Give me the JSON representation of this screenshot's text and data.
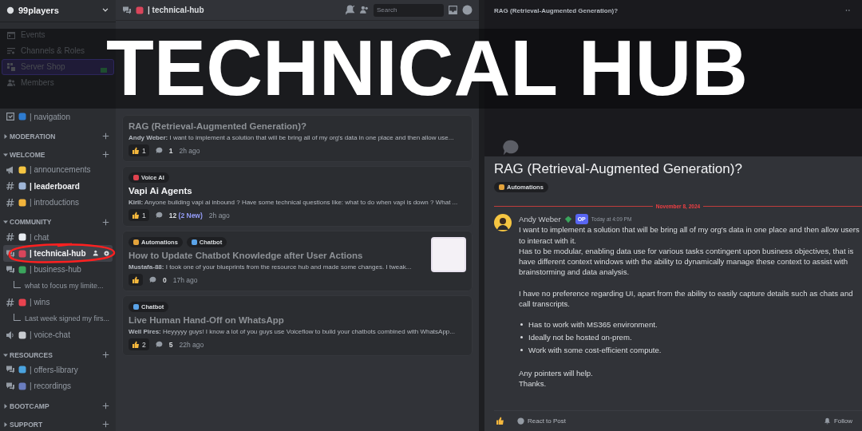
{
  "overlay_title": "TECHNICAL HUB",
  "sidebar": {
    "server_name": "99players",
    "menu": [
      {
        "kind": "events",
        "label": "Events",
        "selected": false
      },
      {
        "kind": "roles",
        "label": "Channels & Roles",
        "selected": false
      },
      {
        "kind": "shop",
        "label": "Server Shop",
        "selected": true
      },
      {
        "kind": "members",
        "label": "Members",
        "selected": false
      }
    ],
    "pinned": [
      {
        "kind": "rules",
        "label": "| navigation",
        "color": "#2e7bcf",
        "unread": false,
        "selected": false
      }
    ],
    "categories": [
      {
        "name": "MODERATION",
        "expanded": false
      },
      {
        "name": "WELCOME",
        "expanded": true,
        "channels": [
          {
            "kind": "announce",
            "label": "| announcements",
            "color": "#f5c542",
            "unread": false,
            "selected": false
          },
          {
            "kind": "text",
            "label": "| leaderboard",
            "color": "#9fb6d8",
            "unread": true,
            "selected": false
          },
          {
            "kind": "text",
            "label": "| introductions",
            "color": "#f2b43c",
            "unread": false,
            "selected": false
          }
        ]
      },
      {
        "name": "COMMUNITY",
        "expanded": true,
        "channels": [
          {
            "kind": "text",
            "label": "| chat",
            "color": "#e9edf2",
            "unread": false,
            "selected": false
          },
          {
            "kind": "forum",
            "label": "| technical-hub",
            "color": "#d9455b",
            "unread": true,
            "selected": true
          },
          {
            "kind": "forum",
            "label": "| business-hub",
            "color": "#3ba55d",
            "unread": false,
            "selected": false
          },
          {
            "kind": "thread",
            "label": "what to focus my limite...",
            "unread": false,
            "selected": false
          },
          {
            "kind": "text",
            "label": "| wins",
            "color": "#e8434f",
            "unread": false,
            "selected": false
          },
          {
            "kind": "thread",
            "label": "Last week signed my firs...",
            "unread": false,
            "selected": false
          },
          {
            "kind": "voice",
            "label": "| voice-chat",
            "color": "#c9ccd1",
            "unread": false,
            "selected": false
          }
        ]
      },
      {
        "name": "RESOURCES",
        "expanded": true,
        "channels": [
          {
            "kind": "forum",
            "label": "| offers-library",
            "color": "#4aa3df",
            "unread": false,
            "selected": false
          },
          {
            "kind": "forum",
            "label": "| recordings",
            "color": "#6a7dbf",
            "unread": false,
            "selected": false
          }
        ]
      },
      {
        "name": "BOOTCAMP",
        "expanded": false
      },
      {
        "name": "SUPPORT",
        "expanded": false
      }
    ]
  },
  "forum": {
    "channel_label": "| technical-hub",
    "search": {
      "placeholder": "Search"
    },
    "posts": [
      {
        "title": "RAG (Retrieval-Augmented Generation)?",
        "author": "Andy Weber:",
        "snippet": "I want to implement a solution that will be bring all of my org's data in one place and then allow use...",
        "likes": "1",
        "replies": "1",
        "time": "2h ago",
        "read": true
      },
      {
        "tags": [
          {
            "label": "Voice AI",
            "color": "#e0434f"
          }
        ],
        "title": "Vapi Ai Agents",
        "author": "Kiril:",
        "snippet": "Anyone building vapi ai inbound ? Have some technical questions like: what to do when vapi is down ? What ...",
        "likes": "1",
        "replies": "12",
        "new_replies": "(2 New)",
        "time": "2h ago",
        "read": false
      },
      {
        "tags": [
          {
            "label": "Automations",
            "color": "#e3a33b"
          },
          {
            "label": "Chatbot",
            "color": "#5aa3e8"
          }
        ],
        "title": "How to Update Chatbot Knowledge after User Actions",
        "author": "Mustafa-88:",
        "snippet": "I took one of your blueprints from the resource hub and made some changes. I tweak...",
        "replies": "0",
        "time": "17h ago",
        "read": true,
        "thumbnail": true
      },
      {
        "tags": [
          {
            "label": "Chatbot",
            "color": "#5aa3e8"
          }
        ],
        "title": "Live Human Hand-Off on WhatsApp",
        "author": "Well Pires:",
        "snippet": "Heyyyyy guys! I know a lot of you guys use Voiceflow to build your chatbots combined with WhatsApp...",
        "likes": "2",
        "replies": "5",
        "time": "22h ago",
        "read": true
      }
    ]
  },
  "thread": {
    "header_title": "RAG (Retrieval-Augmented Generation)?",
    "title": "RAG (Retrieval-Augmented Generation)?",
    "tags": [
      {
        "label": "Automations",
        "color": "#e3a33b"
      }
    ],
    "date_divider": "November 8, 2024",
    "message": {
      "author": "Andy Weber",
      "badge": "OP",
      "time": "Today at 4:09 PM",
      "body": [
        {
          "kind": "text",
          "lines": [
            "I want to implement a solution that will be bring all of my org's data in one place and then allow users to interact with it.",
            "Has to be modular, enabling data use for various tasks contingent upon business objectives, that is have different context windows with the ability to dynamically manage these context to assist with brainstorming and data analysis."
          ]
        },
        {
          "kind": "text",
          "lines": [
            "I have no preference regarding UI, apart from the ability to easily capture details such as chats and call transcripts."
          ]
        },
        {
          "kind": "bullets",
          "lines": [
            "Has to work with MS365 environment.",
            "Ideally not be hosted on-prem.",
            "Work with some cost-efficient compute."
          ]
        },
        {
          "kind": "text",
          "lines": [
            "Any pointers will help.",
            "Thanks."
          ]
        }
      ]
    },
    "react_label": "React to Post",
    "follow_label": "Follow"
  }
}
